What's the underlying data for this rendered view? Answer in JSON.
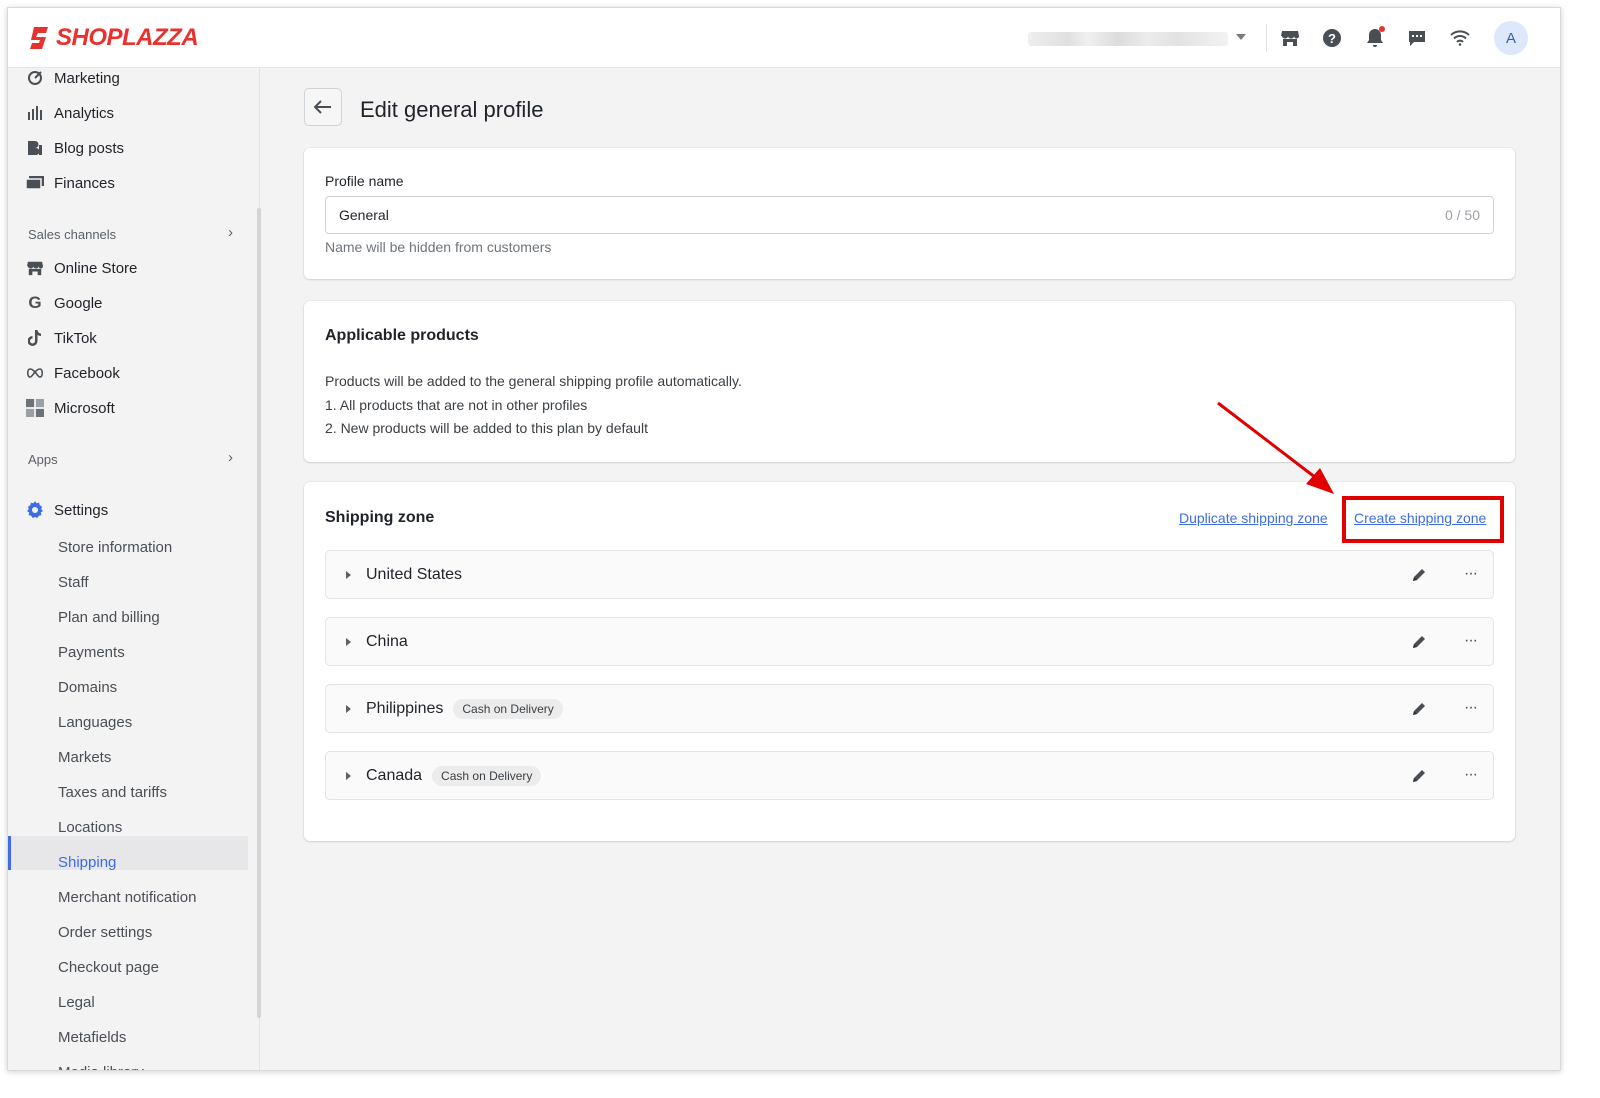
{
  "header": {
    "logo_text": "SHOPLAZZA",
    "avatar_initial": "A",
    "icons": [
      "store-icon",
      "help-icon",
      "bell-icon",
      "chat-icon",
      "wifi-icon"
    ]
  },
  "sidebar": {
    "top_items": [
      {
        "label": "Marketing",
        "icon": "marketing-icon"
      },
      {
        "label": "Analytics",
        "icon": "analytics-icon"
      },
      {
        "label": "Blog posts",
        "icon": "blog-icon"
      },
      {
        "label": "Finances",
        "icon": "finances-icon"
      }
    ],
    "sales_channels_label": "Sales channels",
    "channels": [
      {
        "label": "Online Store",
        "icon": "store-icon"
      },
      {
        "label": "Google",
        "icon": "google-icon"
      },
      {
        "label": "TikTok",
        "icon": "tiktok-icon"
      },
      {
        "label": "Facebook",
        "icon": "meta-icon"
      },
      {
        "label": "Microsoft",
        "icon": "microsoft-icon"
      }
    ],
    "apps_label": "Apps",
    "settings_label": "Settings",
    "settings_items": [
      "Store information",
      "Staff",
      "Plan and billing",
      "Payments",
      "Domains",
      "Languages",
      "Markets",
      "Taxes and tariffs",
      "Locations",
      "Shipping",
      "Merchant notification",
      "Order settings",
      "Checkout page",
      "Legal",
      "Metafields",
      "Media library"
    ],
    "active_item": "Shipping"
  },
  "page": {
    "title": "Edit general profile"
  },
  "profile": {
    "label": "Profile name",
    "value": "General",
    "count": "0 / 50",
    "help": "Name will be hidden from customers"
  },
  "applicable": {
    "title": "Applicable products",
    "lines": [
      "Products will be added to the general shipping profile automatically.",
      "1. All products that are not in other profiles",
      "2. New products will be added to this plan by default"
    ]
  },
  "shipping_zone": {
    "title": "Shipping zone",
    "duplicate_link": "Duplicate shipping zone",
    "create_link": "Create shipping zone",
    "zones": [
      {
        "name": "United States",
        "tag": ""
      },
      {
        "name": "China",
        "tag": ""
      },
      {
        "name": "Philippines",
        "tag": "Cash on Delivery"
      },
      {
        "name": "Canada",
        "tag": "Cash on Delivery"
      }
    ]
  },
  "colors": {
    "brand": "#e8322f",
    "accent": "#3d6ce4",
    "highlight": "#e00000"
  }
}
